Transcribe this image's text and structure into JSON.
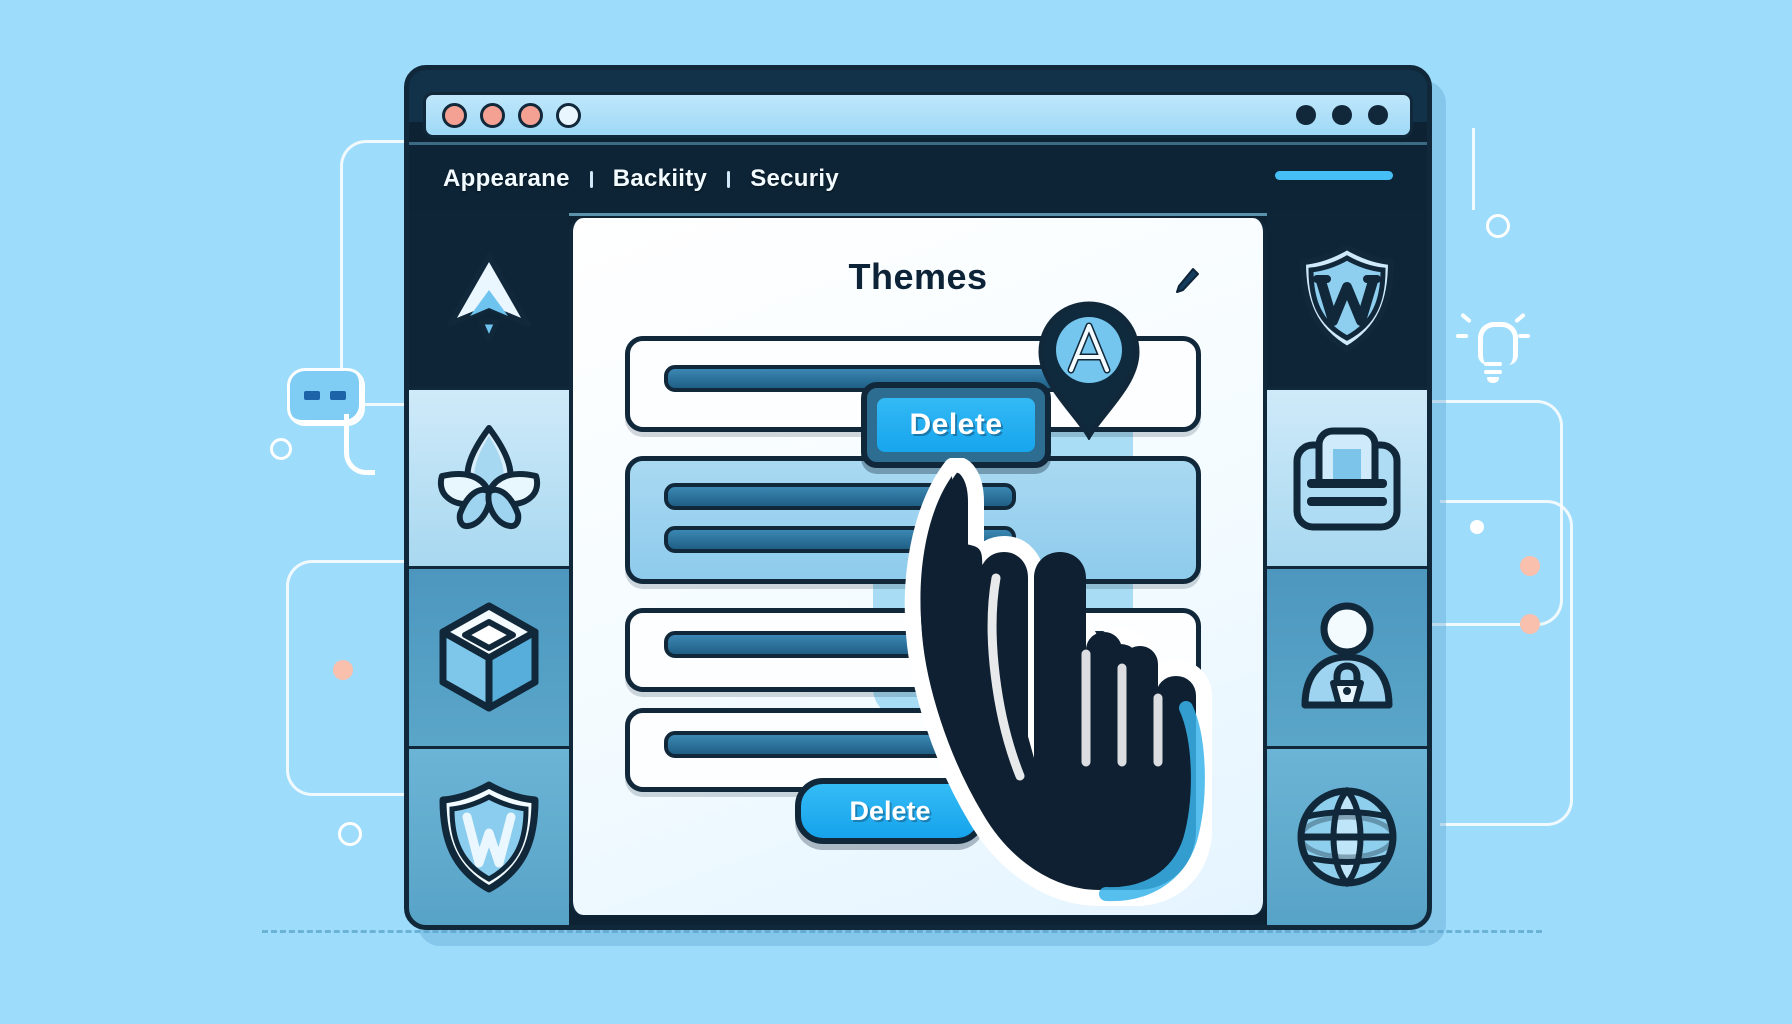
{
  "page": {
    "background_color": "#9ddcfb",
    "title": "WordPress theme deletion illustration"
  },
  "window": {
    "frame_color": "#11283a",
    "titlebar": {
      "left_dots": [
        {
          "name": "close-dot",
          "color": "#f4a193"
        },
        {
          "name": "minimize-dot",
          "color": "#f4a193"
        },
        {
          "name": "maximize-dot",
          "color": "#f4a193"
        },
        {
          "name": "extra-dot",
          "color": "#eaf6fd"
        }
      ],
      "right_dots": [
        {
          "name": "menu-dot-1",
          "color": "#11283a"
        },
        {
          "name": "menu-dot-2",
          "color": "#11283a"
        },
        {
          "name": "menu-dot-3",
          "color": "#11283a"
        }
      ]
    },
    "navbar": {
      "items": [
        {
          "label": "Appearane"
        },
        {
          "label": "Backiity"
        },
        {
          "label": "Securiy"
        }
      ],
      "separator": "|",
      "accent_pill_color": "#46bff5"
    }
  },
  "left_rail": {
    "items": [
      {
        "icon": "arrow-up-triangle-icon",
        "background": "#0e2437"
      },
      {
        "icon": "leaf-flower-icon",
        "background": "#cfeaf9"
      },
      {
        "icon": "cube-box-icon",
        "background": "#4d97bf"
      },
      {
        "icon": "shield-w-icon",
        "background": "#6cb4d6"
      }
    ]
  },
  "right_rail": {
    "items": [
      {
        "icon": "wordpress-shield-icon",
        "background": "#0e2437"
      },
      {
        "icon": "clipboard-document-icon",
        "background": "#cfeaf9"
      },
      {
        "icon": "user-lock-icon",
        "background": "#4d97bf"
      },
      {
        "icon": "globe-icon",
        "background": "#6cb4d6"
      }
    ]
  },
  "main": {
    "title": "Themes",
    "edit_icon": "pencil-edit-icon",
    "theme_rows": [
      {
        "name": "theme-row-1",
        "state": "empty",
        "lines": 1
      },
      {
        "name": "theme-row-2",
        "state": "selected",
        "lines": 2
      },
      {
        "name": "theme-row-3",
        "state": "empty",
        "lines": 1
      },
      {
        "name": "theme-row-4",
        "state": "empty",
        "lines": 1
      }
    ],
    "delete_button": {
      "label": "Delete",
      "state": "pressed",
      "fill_color": "#17a5ed"
    },
    "confirm_button": {
      "label": "Delete",
      "fill_color": "#16a3ec"
    },
    "map_pin": {
      "icon": "location-pin-a-icon",
      "letter": "A"
    },
    "cursor": {
      "icon": "hand-pointer-cursor"
    }
  },
  "decorations": {
    "chat_icon": "chat-bubble-icon",
    "bulb_icon": "lightbulb-icon",
    "dots": [
      {
        "color": "#ffffff"
      },
      {
        "color": "#f6b9a6"
      },
      {
        "color": "#f6b9a6"
      },
      {
        "color": "#ffffff"
      },
      {
        "color": "#ffffff"
      }
    ]
  }
}
